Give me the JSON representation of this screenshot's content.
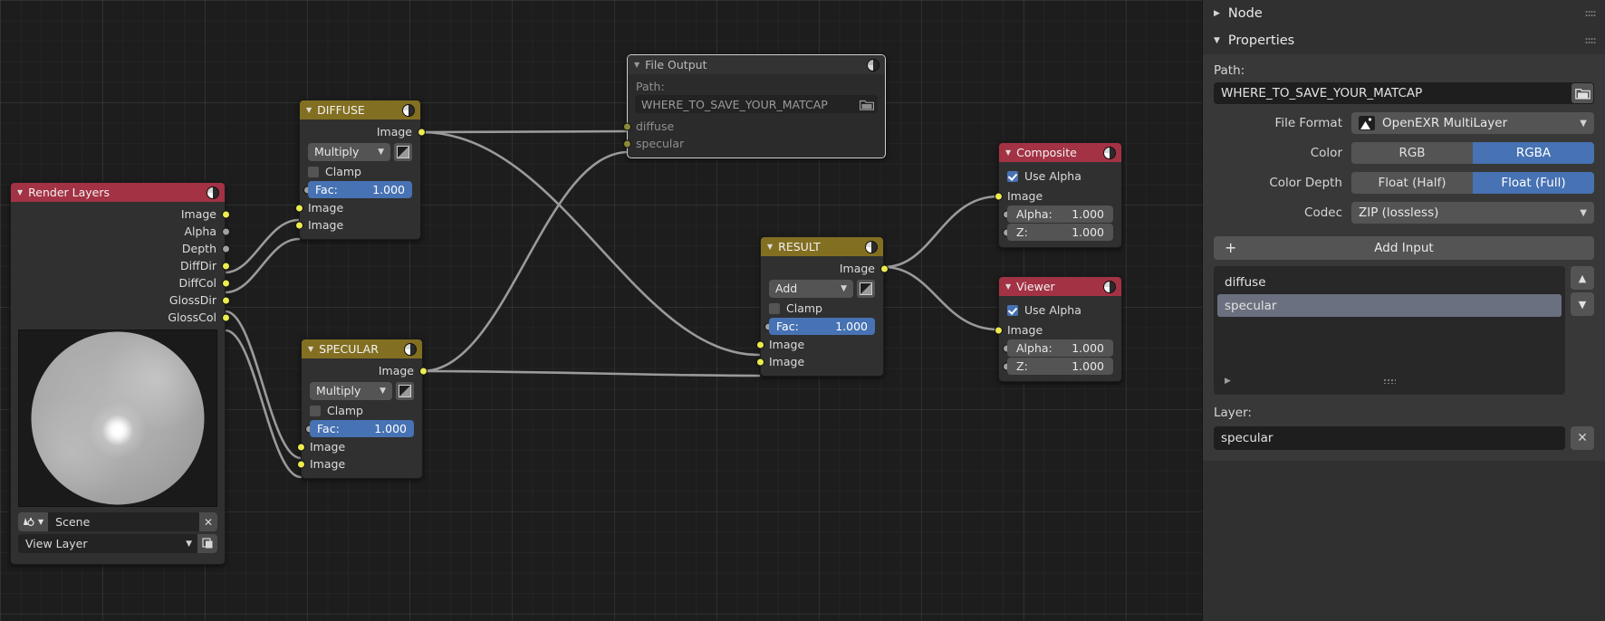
{
  "nodes": {
    "render_layers": {
      "title": "Render Layers",
      "outputs": [
        "Image",
        "Alpha",
        "Depth",
        "DiffDir",
        "DiffCol",
        "GlossDir",
        "GlossCol"
      ],
      "scene_value": "Scene",
      "layer_value": "View Layer",
      "close_label": "✕"
    },
    "diffuse": {
      "title": "DIFFUSE",
      "output_label": "Image",
      "blend_mode": "Multiply",
      "clamp_label": "Clamp",
      "fac_label": "Fac:",
      "fac_value": "1.000",
      "input_a": "Image",
      "input_b": "Image"
    },
    "specular": {
      "title": "SPECULAR",
      "output_label": "Image",
      "blend_mode": "Multiply",
      "clamp_label": "Clamp",
      "fac_label": "Fac:",
      "fac_value": "1.000",
      "input_a": "Image",
      "input_b": "Image"
    },
    "result": {
      "title": "RESULT",
      "output_label": "Image",
      "blend_mode": "Add",
      "clamp_label": "Clamp",
      "fac_label": "Fac:",
      "fac_value": "1.000",
      "input_a": "Image",
      "input_b": "Image"
    },
    "file_output": {
      "title": "File Output",
      "path_label": "Path:",
      "path_value": "WHERE_TO_SAVE_YOUR_MATCAP",
      "inputs": [
        "diffuse",
        "specular"
      ]
    },
    "composite": {
      "title": "Composite",
      "use_alpha_label": "Use Alpha",
      "image_label": "Image",
      "alpha_label": "Alpha:",
      "alpha_value": "1.000",
      "z_label": "Z:",
      "z_value": "1.000"
    },
    "viewer": {
      "title": "Viewer",
      "use_alpha_label": "Use Alpha",
      "image_label": "Image",
      "alpha_label": "Alpha:",
      "alpha_value": "1.000",
      "z_label": "Z:",
      "z_value": "1.000"
    }
  },
  "sidebar": {
    "node_panel_title": "Node",
    "properties_panel_title": "Properties",
    "path_label": "Path:",
    "path_value": "WHERE_TO_SAVE_YOUR_MATCAP",
    "file_format_label": "File Format",
    "file_format_value": "OpenEXR MultiLayer",
    "color_label": "Color",
    "color_rgb": "RGB",
    "color_rgba": "RGBA",
    "color_depth_label": "Color Depth",
    "depth_half": "Float (Half)",
    "depth_full": "Float (Full)",
    "codec_label": "Codec",
    "codec_value": "ZIP (lossless)",
    "add_input_label": "Add Input",
    "inputs": [
      "diffuse",
      "specular"
    ],
    "selected_input": "specular",
    "layer_label": "Layer:",
    "layer_value": "specular",
    "move_up_label": "▲",
    "move_down_label": "▼",
    "remove_label": "✕"
  },
  "colors": {
    "header_yellow": "#836f21",
    "header_red": "#a33244",
    "accent_blue": "#4772b3",
    "socket_yellow": "#ecec4e",
    "socket_grey": "#a1a1a1",
    "canvas_bg": "#1d1d1d",
    "node_bg": "#303030",
    "sidebar_bg": "#383838"
  }
}
